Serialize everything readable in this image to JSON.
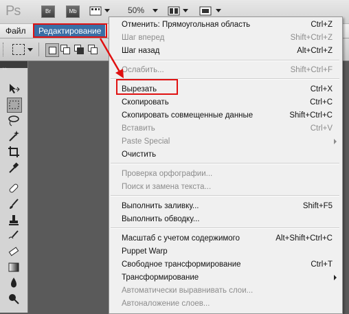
{
  "app": {
    "logo": "Ps"
  },
  "toolbar": {
    "bridge_label": "Br",
    "minibridge_label": "Mb",
    "zoom": "50%"
  },
  "menubar": {
    "items": [
      {
        "label": "Файл"
      },
      {
        "label": "Редактирование"
      }
    ]
  },
  "edit_menu": {
    "items": [
      {
        "label": "Отменить: Прямоугольная область",
        "shortcut": "Ctrl+Z",
        "enabled": true
      },
      {
        "label": "Шаг вперед",
        "shortcut": "Shift+Ctrl+Z",
        "enabled": false
      },
      {
        "label": "Шаг назад",
        "shortcut": "Alt+Ctrl+Z",
        "enabled": true
      },
      {
        "label": "Ослабить...",
        "shortcut": "Shift+Ctrl+F",
        "enabled": false
      },
      {
        "label": "Вырезать",
        "shortcut": "Ctrl+X",
        "enabled": true
      },
      {
        "label": "Скопировать",
        "shortcut": "Ctrl+C",
        "enabled": true
      },
      {
        "label": "Скопировать совмещенные данные",
        "shortcut": "Shift+Ctrl+C",
        "enabled": true
      },
      {
        "label": "Вставить",
        "shortcut": "Ctrl+V",
        "enabled": false
      },
      {
        "label": "Paste Special",
        "shortcut": "",
        "enabled": false,
        "submenu": true
      },
      {
        "label": "Очистить",
        "shortcut": "",
        "enabled": true
      },
      {
        "label": "Проверка орфографии...",
        "shortcut": "",
        "enabled": false
      },
      {
        "label": "Поиск и замена текста...",
        "shortcut": "",
        "enabled": false
      },
      {
        "label": "Выполнить заливку...",
        "shortcut": "Shift+F5",
        "enabled": true
      },
      {
        "label": "Выполнить обводку...",
        "shortcut": "",
        "enabled": true
      },
      {
        "label": "Масштаб с учетом содержимого",
        "shortcut": "Alt+Shift+Ctrl+C",
        "enabled": true
      },
      {
        "label": "Puppet Warp",
        "shortcut": "",
        "enabled": true
      },
      {
        "label": "Свободное трансформирование",
        "shortcut": "Ctrl+T",
        "enabled": true
      },
      {
        "label": "Трансформирование",
        "shortcut": "",
        "enabled": true,
        "submenu": true
      },
      {
        "label": "Автоматически выравнивать слои...",
        "shortcut": "",
        "enabled": false
      },
      {
        "label": "Автоналожение слоев...",
        "shortcut": "",
        "enabled": false
      }
    ]
  },
  "colors": {
    "highlight_border": "#e01010",
    "menu_active": "#3a6ea5",
    "canvas": "#5a5a5a"
  }
}
